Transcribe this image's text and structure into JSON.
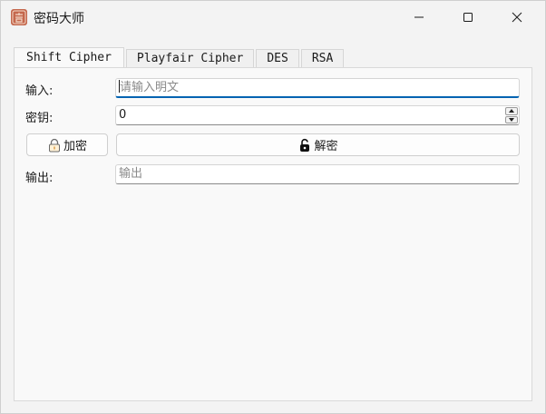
{
  "window": {
    "title": "密码大师",
    "app_icon": "cipher-seal-icon",
    "controls": [
      "minimize-icon",
      "maximize-icon",
      "close-icon"
    ]
  },
  "tabs": [
    {
      "label": "Shift Cipher",
      "active": true
    },
    {
      "label": "Playfair Cipher",
      "active": false
    },
    {
      "label": "DES",
      "active": false
    },
    {
      "label": "RSA",
      "active": false
    }
  ],
  "form": {
    "input_label": "输入:",
    "input_placeholder": "请输入明文",
    "input_value": "",
    "key_label": "密钥:",
    "key_value": "0",
    "encrypt_button": "加密",
    "encrypt_icon": "padlock-icon",
    "decrypt_button": "解密",
    "decrypt_icon": "unlock-icon",
    "output_label": "输出:",
    "output_placeholder": "输出",
    "output_value": ""
  },
  "colors": {
    "focus_accent": "#0063b1",
    "background": "#f3f3f3",
    "panel": "#f9f9f9"
  }
}
